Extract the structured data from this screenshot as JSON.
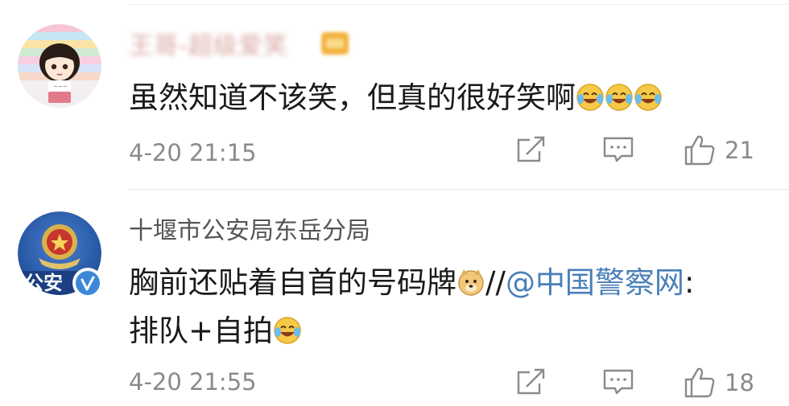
{
  "comments": [
    {
      "username": "王哥-超级爱笑",
      "text_prefix": "虽然知道不该笑，但真的很好笑啊",
      "emojis": [
        "laugh-cry",
        "laugh-cry",
        "laugh-cry"
      ],
      "time": "4-20 21:15",
      "likes": "21"
    },
    {
      "username": "十堰市公安局东岳分局",
      "avatar_text": "公安",
      "text_line1": "胸前还贴着自首的号码牌",
      "text_sep": "//",
      "mention": "@中国警察网",
      "text_colon": ":",
      "text_line2": "排队+自拍",
      "time": "4-20 21:55",
      "likes": "18"
    }
  ],
  "colors": {
    "mention": "#4a7fb8",
    "meta": "#8a8a8a",
    "text": "#1a1a1a",
    "verified": "#3c88d8",
    "police_blue": "#2e5fa8"
  },
  "icons": {
    "share": "share-icon",
    "reply": "reply-icon",
    "like": "thumbs-up-icon",
    "verified": "verified-badge-icon"
  }
}
